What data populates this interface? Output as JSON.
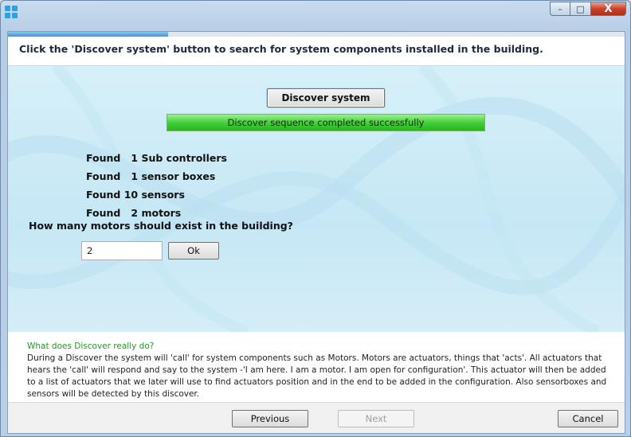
{
  "instruction": "Click the 'Discover system' button to search for system components installed in the building.",
  "progress_fraction": 0.26,
  "discover_button": "Discover system",
  "status": "Discover sequence completed successfully",
  "found": [
    {
      "text": "Found   1 Sub controllers"
    },
    {
      "text": "Found   1 sensor boxes"
    },
    {
      "text": "Found 10 sensors"
    },
    {
      "text": "Found   2 motors"
    }
  ],
  "question": "How many motors should exist in the building?",
  "motors_value": "2",
  "ok_label": "Ok",
  "help": {
    "title": "What does Discover really do?",
    "text": "During a Discover the system will 'call' for system components such as Motors. Motors are actuators, things that 'acts'. All actuators that hears the 'call' will respond and say to the system -'I am here. I am a motor. I am open for configuration'. This actuator will then be added to a list of actuators that we later will use to find actuators position and in the end to be added in the configuration. Also sensorboxes and sensors will be detected by this discover."
  },
  "footer": {
    "previous": "Previous",
    "next": "Next",
    "cancel": "Cancel"
  },
  "caption": {
    "minimize": "–",
    "maximize": "□",
    "close": "X"
  },
  "colors": {
    "status_green": "#46cf3c",
    "help_title": "#1f9b1f",
    "progress_blue": "#3a96d6"
  }
}
